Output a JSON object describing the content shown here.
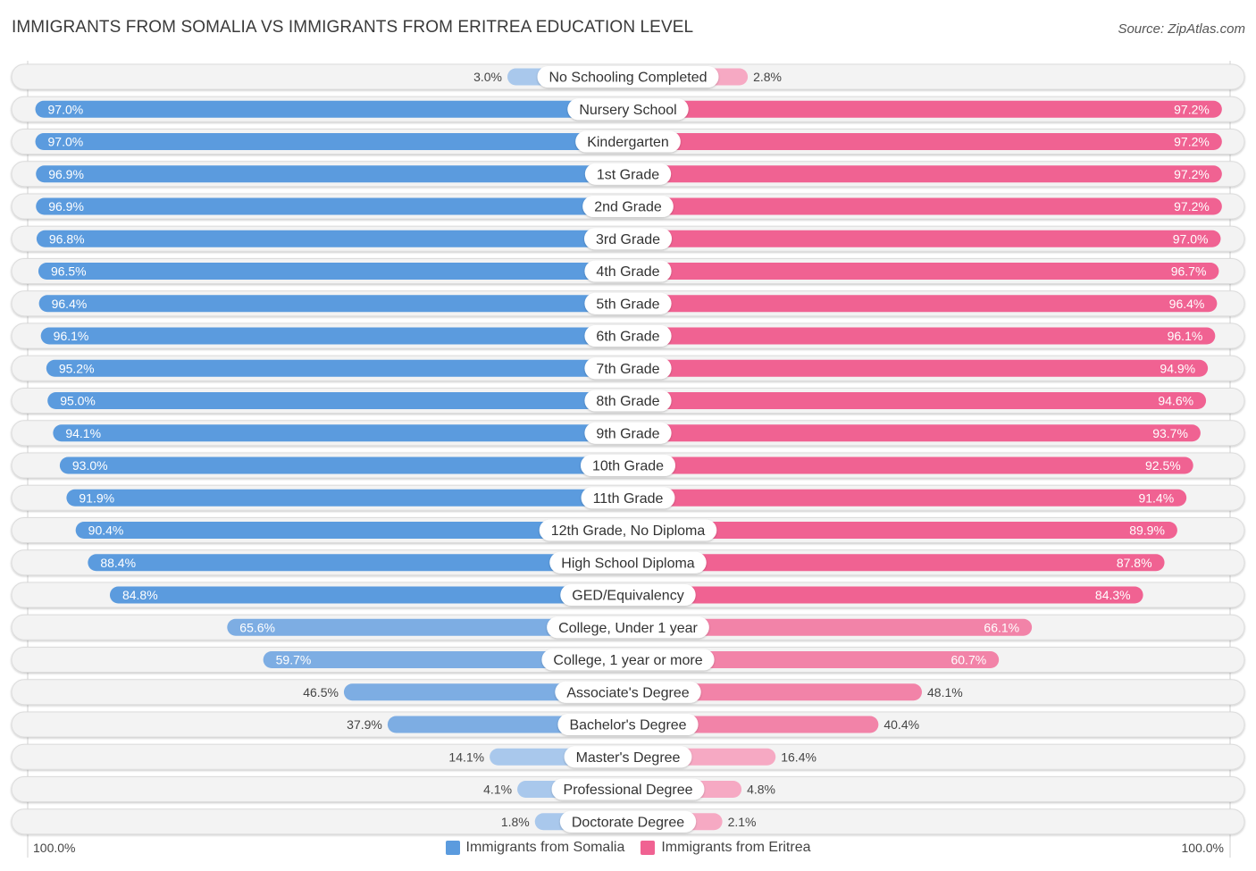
{
  "header": {
    "title": "IMMIGRANTS FROM SOMALIA VS IMMIGRANTS FROM ERITREA EDUCATION LEVEL",
    "source": "Source: ZipAtlas.com"
  },
  "colors": {
    "somalia": "#5b9bde",
    "somalia_light": "#a9c8ec",
    "eritrea": "#f06292",
    "eritrea_light": "#f6a9c3",
    "track": "#f3f3f3"
  },
  "chart_data": {
    "type": "bar",
    "orientation": "horizontal-diverging",
    "title": "IMMIGRANTS FROM SOMALIA VS IMMIGRANTS FROM ERITREA EDUCATION LEVEL",
    "xlabel": "",
    "ylabel": "",
    "xlim": [
      0,
      100
    ],
    "axis_left_label": "100.0%",
    "axis_right_label": "100.0%",
    "legend_position": "bottom-center",
    "categories": [
      "No Schooling Completed",
      "Nursery School",
      "Kindergarten",
      "1st Grade",
      "2nd Grade",
      "3rd Grade",
      "4th Grade",
      "5th Grade",
      "6th Grade",
      "7th Grade",
      "8th Grade",
      "9th Grade",
      "10th Grade",
      "11th Grade",
      "12th Grade, No Diploma",
      "High School Diploma",
      "GED/Equivalency",
      "College, Under 1 year",
      "College, 1 year or more",
      "Associate's Degree",
      "Bachelor's Degree",
      "Master's Degree",
      "Professional Degree",
      "Doctorate Degree"
    ],
    "series": [
      {
        "name": "Immigrants from Somalia",
        "side": "left",
        "values": [
          3.0,
          97.0,
          97.0,
          96.9,
          96.9,
          96.8,
          96.5,
          96.4,
          96.1,
          95.2,
          95.0,
          94.1,
          93.0,
          91.9,
          90.4,
          88.4,
          84.8,
          65.6,
          59.7,
          46.5,
          37.9,
          14.1,
          4.1,
          1.8
        ],
        "labels": [
          "3.0%",
          "97.0%",
          "97.0%",
          "96.9%",
          "96.9%",
          "96.8%",
          "96.5%",
          "96.4%",
          "96.1%",
          "95.2%",
          "95.0%",
          "94.1%",
          "93.0%",
          "91.9%",
          "90.4%",
          "88.4%",
          "84.8%",
          "65.6%",
          "59.7%",
          "46.5%",
          "37.9%",
          "14.1%",
          "4.1%",
          "1.8%"
        ]
      },
      {
        "name": "Immigrants from Eritrea",
        "side": "right",
        "values": [
          2.8,
          97.2,
          97.2,
          97.2,
          97.2,
          97.0,
          96.7,
          96.4,
          96.1,
          94.9,
          94.6,
          93.7,
          92.5,
          91.4,
          89.9,
          87.8,
          84.3,
          66.1,
          60.7,
          48.1,
          40.4,
          16.4,
          4.8,
          2.1
        ],
        "labels": [
          "2.8%",
          "97.2%",
          "97.2%",
          "97.2%",
          "97.2%",
          "97.0%",
          "96.7%",
          "96.4%",
          "96.1%",
          "94.9%",
          "94.6%",
          "93.7%",
          "92.5%",
          "91.4%",
          "89.9%",
          "87.8%",
          "84.3%",
          "66.1%",
          "60.7%",
          "48.1%",
          "40.4%",
          "16.4%",
          "4.8%",
          "2.1%"
        ]
      }
    ]
  },
  "legend": {
    "items": [
      {
        "label": "Immigrants from Somalia",
        "color": "#5b9bde"
      },
      {
        "label": "Immigrants from Eritrea",
        "color": "#f06292"
      }
    ]
  }
}
